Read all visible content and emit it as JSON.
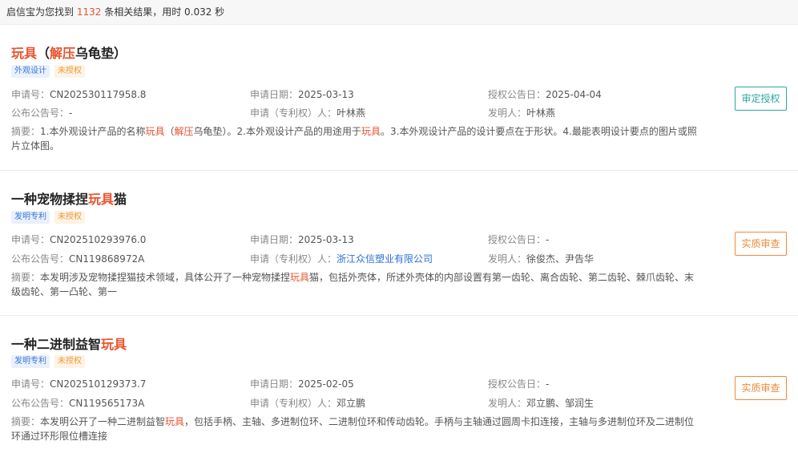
{
  "summary": {
    "prefix": "启信宝为您找到 ",
    "count": "1132",
    "suffix": " 条相关结果，用时 0.032 秒"
  },
  "labels": {
    "app_no": "申请号：",
    "app_date": "申请日期：",
    "grant_date": "授权公告日：",
    "pub_no": "公布公告号：",
    "applicant": "申请（专利权）人：",
    "inventor": "发明人：",
    "abstract": "摘要："
  },
  "results": [
    {
      "title_parts": [
        {
          "text": "玩具",
          "hl": true
        },
        {
          "text": "（",
          "hl": false
        },
        {
          "text": "解压",
          "hl": true
        },
        {
          "text": "乌龟垫）",
          "hl": false
        }
      ],
      "type_tag": "外观设计",
      "status_tag": "未授权",
      "app_no": "CN202530117958.8",
      "app_date": "2025-03-13",
      "grant_date": "2025-04-04",
      "pub_no": "-",
      "applicant": "叶林燕",
      "inventor": "叶林燕",
      "abstract_parts": [
        {
          "text": "1.本外观设计产品的名称",
          "hl": false
        },
        {
          "text": "玩具",
          "hl": true
        },
        {
          "text": "（",
          "hl": false
        },
        {
          "text": "解压",
          "hl": true
        },
        {
          "text": "乌龟垫）。2.本外观设计产品的用途用于",
          "hl": false
        },
        {
          "text": "玩具",
          "hl": true
        },
        {
          "text": "。3.本外观设计产品的设计要点在于形状。4.最能表明设计要点的图片或照片立体图。",
          "hl": false
        }
      ],
      "action": "审定授权",
      "action_style": "teal"
    },
    {
      "title_parts": [
        {
          "text": "一种宠物揉捏",
          "hl": false
        },
        {
          "text": "玩具",
          "hl": true
        },
        {
          "text": "猫",
          "hl": false
        }
      ],
      "type_tag": "发明专利",
      "status_tag": "未授权",
      "app_no": "CN202510293976.0",
      "app_date": "2025-03-13",
      "grant_date": "-",
      "pub_no": "CN119868972A",
      "applicant": "浙江众信塑业有限公司",
      "inventor": "徐俊杰、尹告华",
      "abstract_parts": [
        {
          "text": "本发明涉及宠物揉捏猫技术领域，具体公开了一种宠物揉捏",
          "hl": false
        },
        {
          "text": "玩具",
          "hl": true
        },
        {
          "text": "猫，包括外壳体，所述外壳体的内部设置有第一齿轮、离合齿轮、第二齿轮、棘爪齿轮、末级齿轮、第一凸轮、第一",
          "hl": false
        }
      ],
      "action": "实质审查",
      "action_style": "orange"
    },
    {
      "title_parts": [
        {
          "text": "一种二进制益智",
          "hl": false
        },
        {
          "text": "玩具",
          "hl": true
        }
      ],
      "type_tag": "发明专利",
      "status_tag": "未授权",
      "app_no": "CN202510129373.7",
      "app_date": "2025-02-05",
      "grant_date": "-",
      "pub_no": "CN119565173A",
      "applicant": "邓立鹏",
      "inventor": "邓立鹏、邹润生",
      "abstract_parts": [
        {
          "text": "本发明公开了一种二进制益智",
          "hl": false
        },
        {
          "text": "玩具",
          "hl": true
        },
        {
          "text": "，包括手柄、主轴、多进制位环、二进制位环和传动齿轮。手柄与主轴通过圆周卡扣连接，主轴与多进制位环及二进制位环通过环形限位槽连接",
          "hl": false
        }
      ],
      "action": "实质审查",
      "action_style": "orange"
    }
  ]
}
